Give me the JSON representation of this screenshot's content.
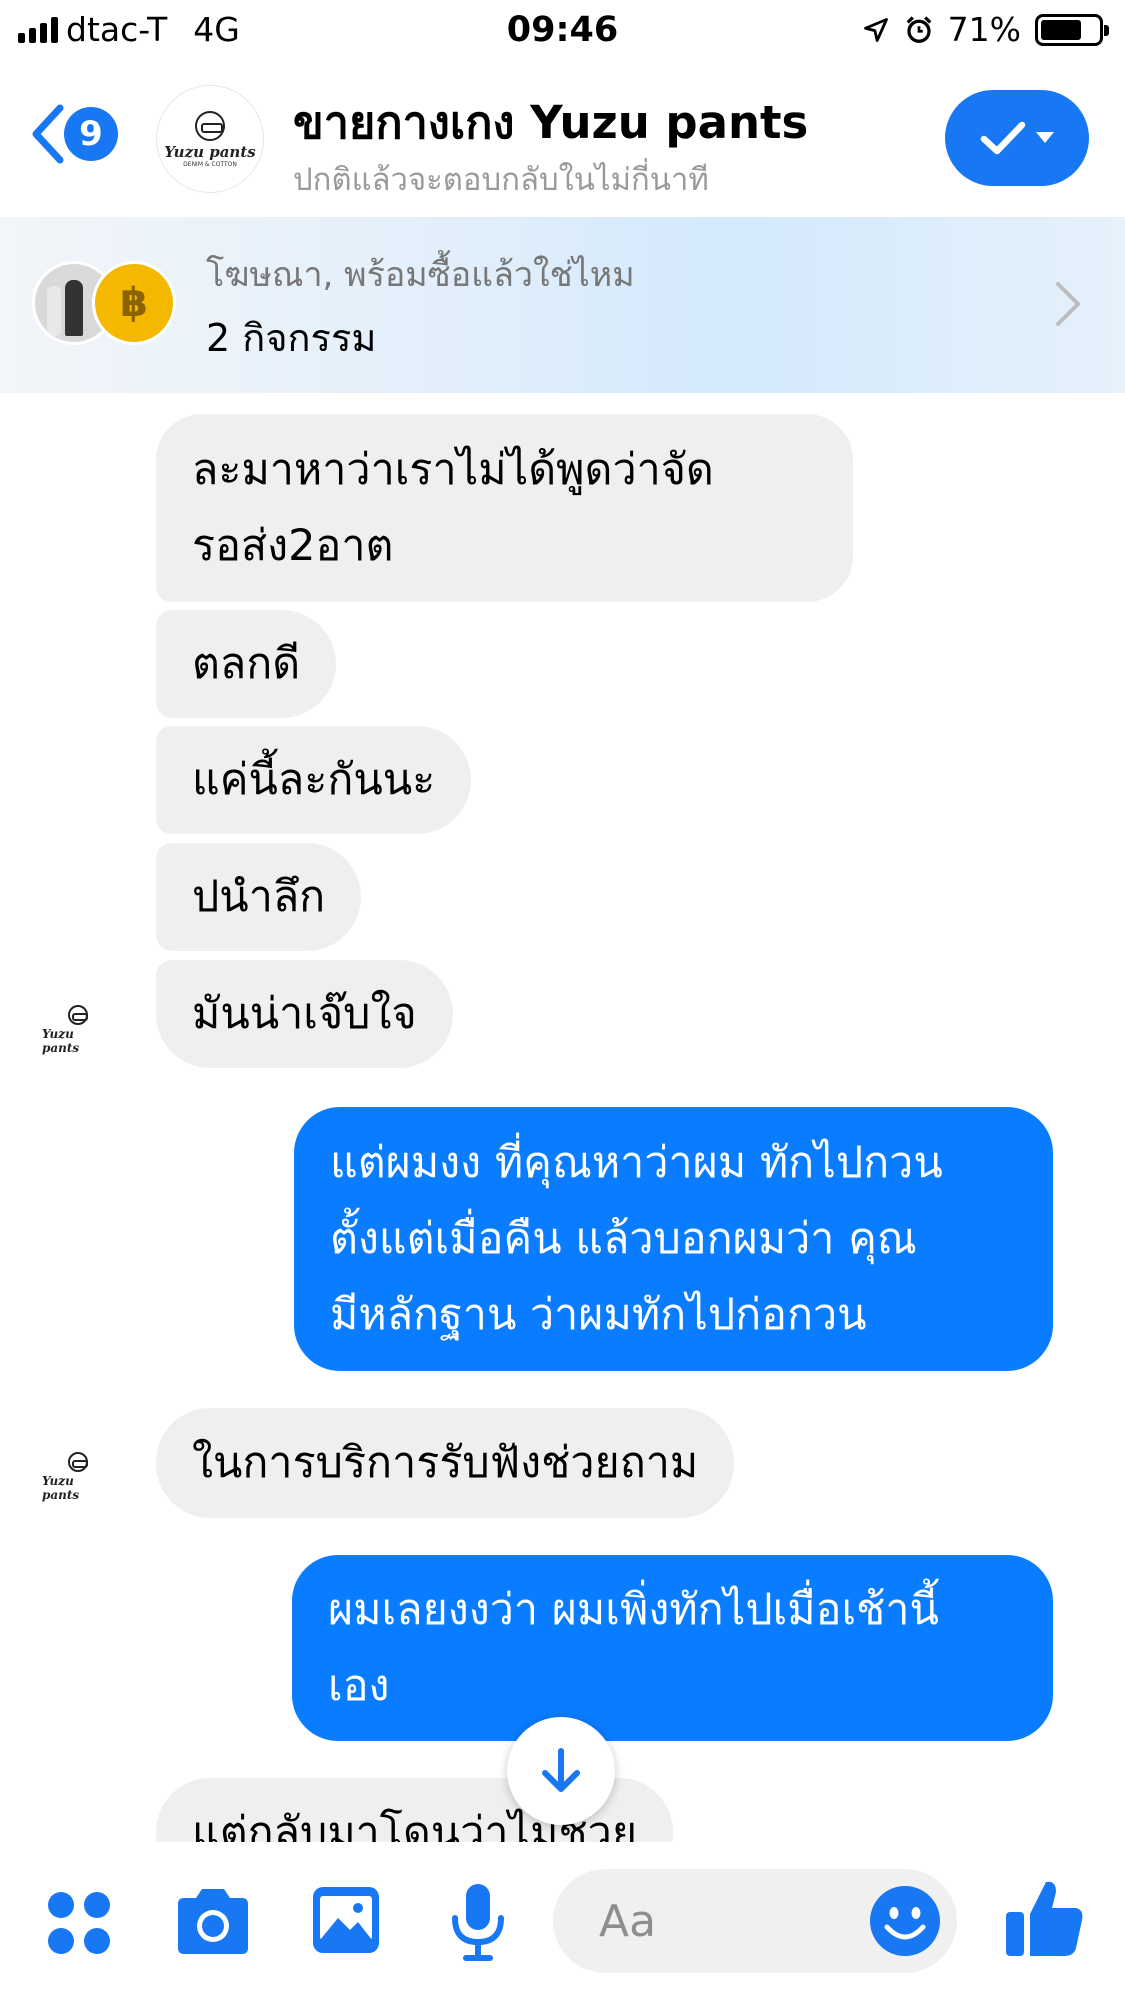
{
  "status_bar": {
    "carrier": "dtac-T",
    "network": "4G",
    "time": "09:46",
    "battery": "71%",
    "battery_level": 0.71
  },
  "header": {
    "back_count": "9",
    "title": "ขายกางเกง Yuzu pants",
    "subtitle": "ปกติแล้วจะตอบกลับในไม่กี่นาที",
    "avatar_logo": "Yuzu pants",
    "avatar_logo_sub": "DENIM & COTTON"
  },
  "ad_banner": {
    "line1": "โฆษณา, พร้อมซื้อแล้วใช่ไหม",
    "line2": "2 กิจกรรม",
    "coin_symbol": "฿"
  },
  "messages": [
    {
      "side": "in",
      "lines": [
        "ละมาหาว่าเราไม่ได้พูดว่าจัด",
        "รอส่ง2อาต"
      ]
    },
    {
      "side": "in",
      "lines": [
        "ตลกดี"
      ]
    },
    {
      "side": "in",
      "lines": [
        "แค่นี้ละกันนะ"
      ]
    },
    {
      "side": "in",
      "lines": [
        "ปนำลึก"
      ]
    },
    {
      "side": "in",
      "lines": [
        "มันน่าเจ๊บใจ"
      ]
    },
    {
      "side": "out",
      "lines": [
        "แต่ผมงง ที่คุณหาว่าผม ทักไปกวน",
        "ตั้งแต่เมื่อคืน แล้วบอกผมว่า คุณ",
        "มีหลักฐาน ว่าผมทักไปก่อกวน"
      ]
    },
    {
      "side": "in",
      "lines": [
        "ในการบริการรับฟังช่วยถาม"
      ]
    },
    {
      "side": "out",
      "lines": [
        "ผมเลยงงว่า ผมเพิ่งทักไปเมื่อเช้านี้",
        "เอง"
      ]
    },
    {
      "side": "in",
      "lines": [
        "แต่กลับมาโดนว่าไม่ช่วย"
      ]
    }
  ],
  "composer": {
    "placeholder": "Aa"
  },
  "colors": {
    "accent": "#1877f2",
    "outgoing_bubble": "#0a7cff",
    "incoming_bubble": "#efefef"
  },
  "icons": [
    "back-chevron-icon",
    "check-icon",
    "dropdown-caret-icon",
    "chevron-right-icon",
    "arrow-down-icon",
    "apps-grid-icon",
    "camera-icon",
    "photo-icon",
    "microphone-icon",
    "emoji-icon",
    "thumbs-up-icon"
  ]
}
